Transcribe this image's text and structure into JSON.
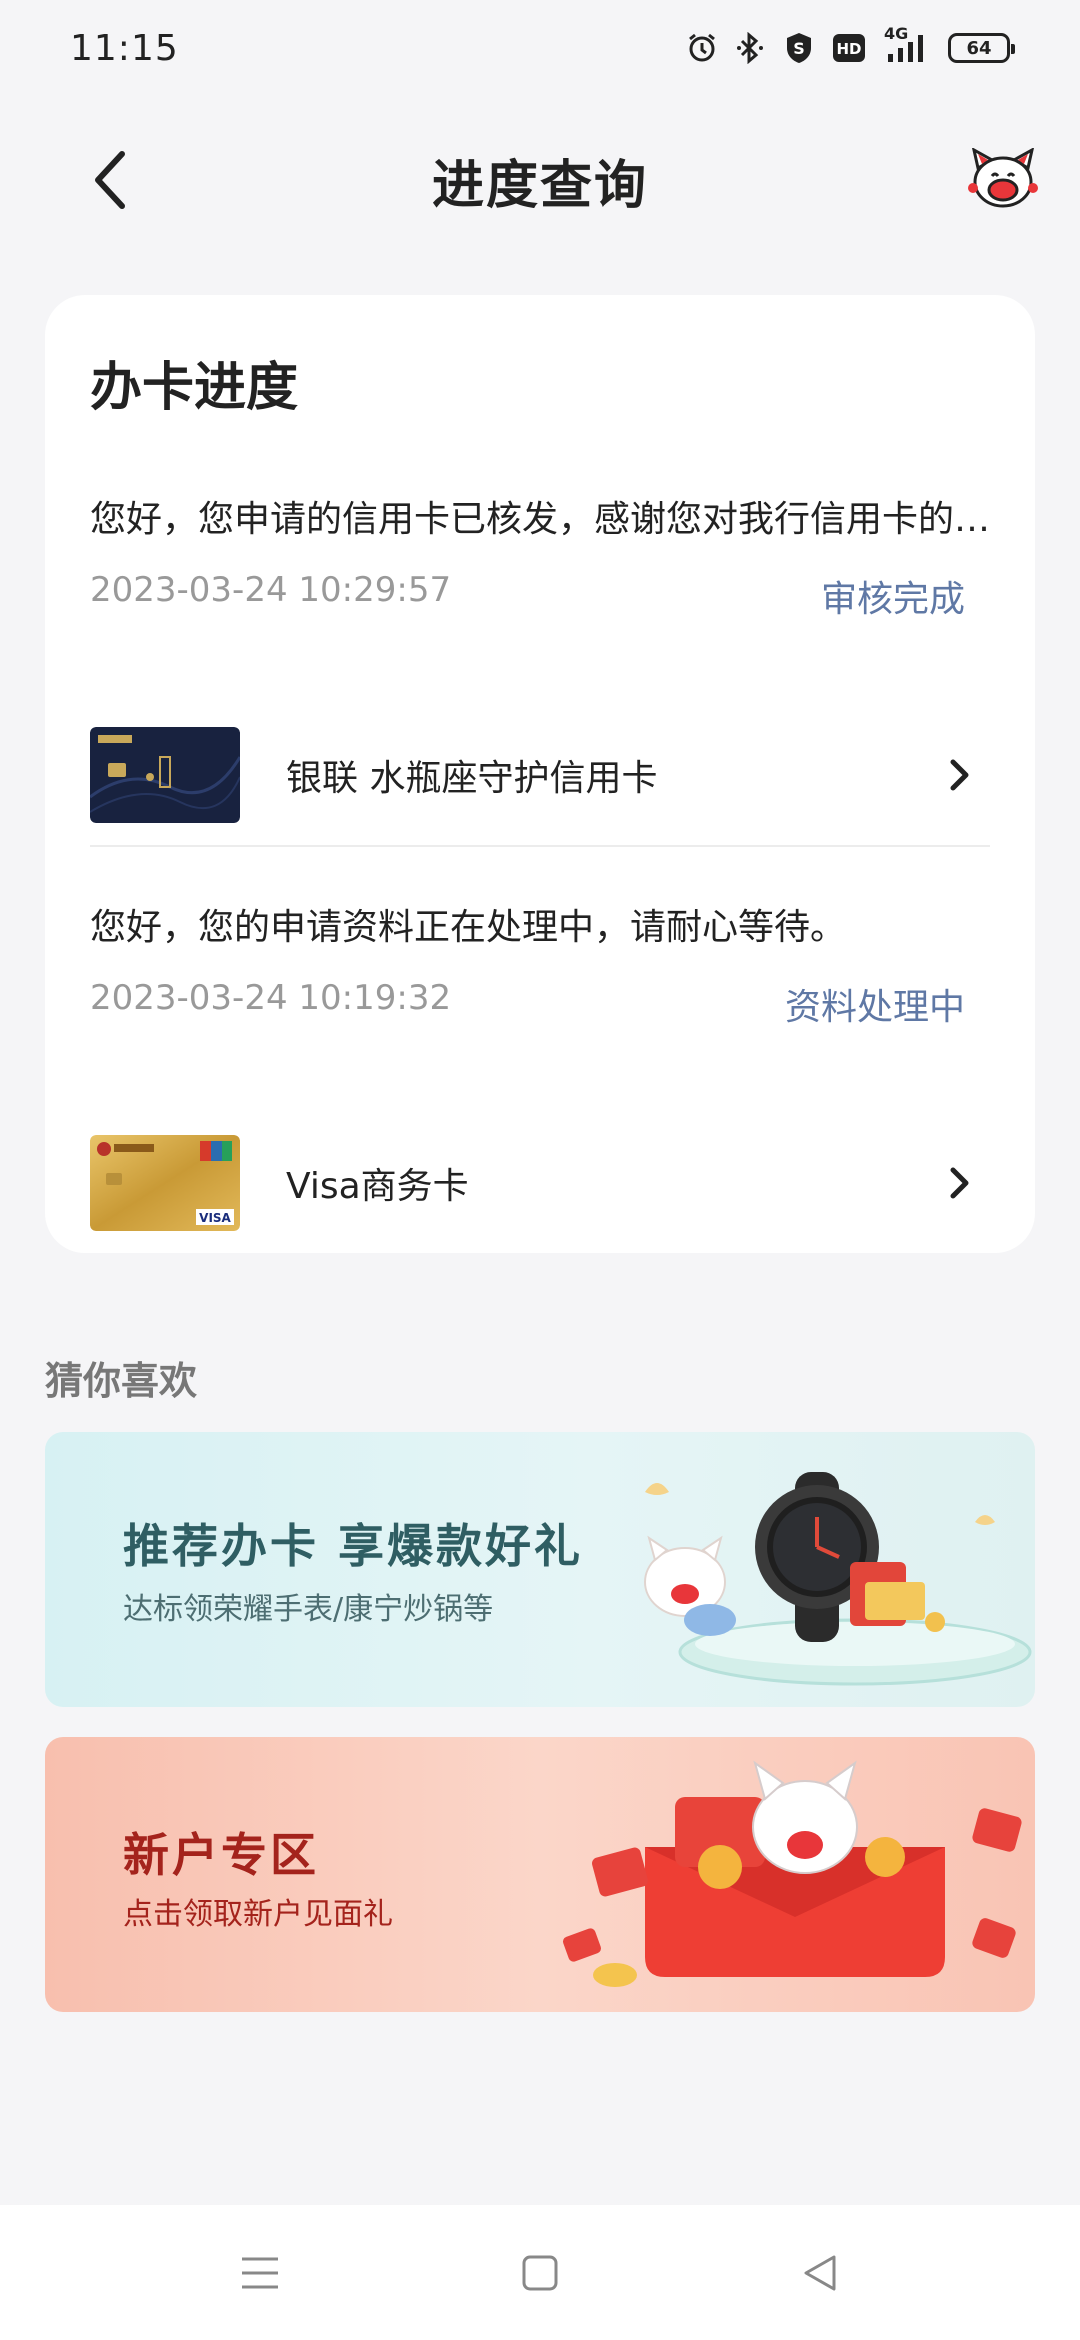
{
  "status_bar": {
    "time": "11:15",
    "battery": "64",
    "network": "4G",
    "hd_label": "HD",
    "icons": [
      "alarm-icon",
      "bluetooth-icon",
      "shield-icon",
      "hd-icon",
      "signal-icon",
      "battery-icon"
    ]
  },
  "header": {
    "title": "进度查询",
    "back_icon": "chevron-left-icon",
    "assistant_icon": "cat-mascot-icon"
  },
  "progress_card": {
    "title": "办卡进度",
    "records": [
      {
        "message": "您好，您申请的信用卡已核发，感谢您对我行信用卡的…",
        "time": "2023-03-24 10:29:57",
        "status": "审核完成",
        "card_name": "银联 水瓶座守护信用卡",
        "card_style": "dark-blue"
      },
      {
        "message": "您好，您的申请资料正在处理中，请耐心等待。",
        "time": "2023-03-24 10:19:32",
        "status": "资料处理中",
        "card_name": "Visa商务卡",
        "card_style": "gold"
      }
    ]
  },
  "recommend": {
    "title": "猜你喜欢",
    "banners": [
      {
        "headline": "推荐办卡 享爆款好礼",
        "subtitle": "达标领荣耀手表/康宁炒锅等"
      },
      {
        "headline": "新户专区",
        "subtitle": "点击领取新户见面礼"
      }
    ]
  },
  "nav_keys": [
    "menu-icon",
    "home-square-icon",
    "back-triangle-icon"
  ],
  "colors": {
    "background": "#f5f5f7",
    "status_accent": "#5f78a5",
    "muted_text": "#999999",
    "banner_red": "#a4231c",
    "banner_teal": "#2f5e63"
  }
}
